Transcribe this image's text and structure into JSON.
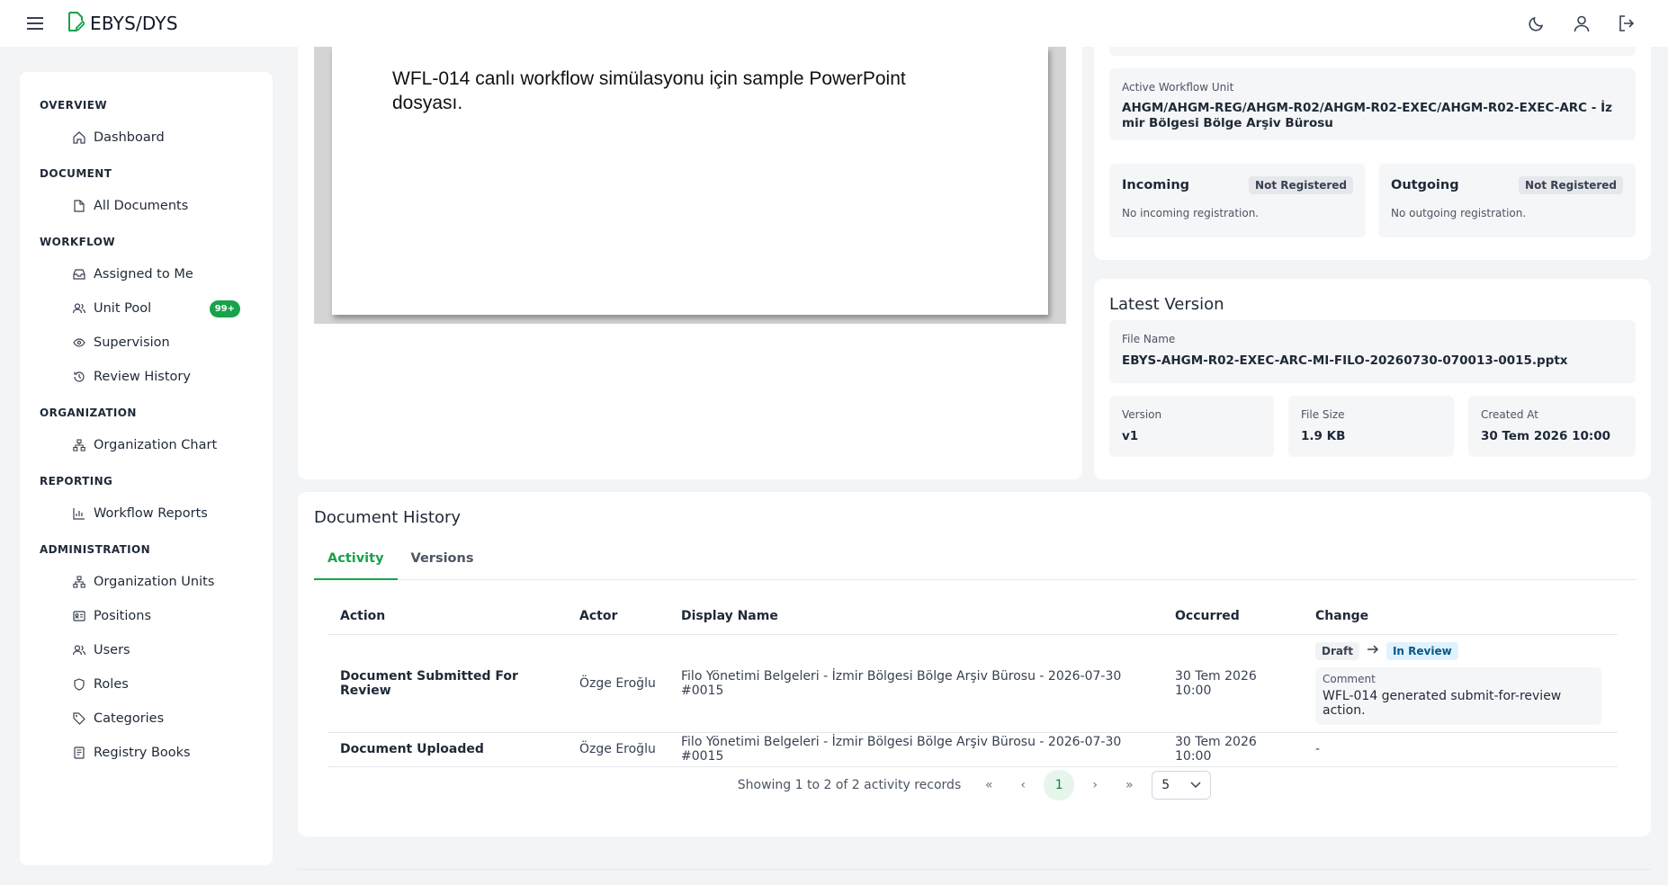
{
  "app": {
    "brand": "EBYS/DYS",
    "accent": "#16a34a"
  },
  "sidebar": {
    "sections": [
      {
        "title": "OVERVIEW",
        "items": [
          {
            "label": "Dashboard",
            "icon": "home-icon"
          }
        ]
      },
      {
        "title": "DOCUMENT",
        "items": [
          {
            "label": "All Documents",
            "icon": "file-icon"
          }
        ]
      },
      {
        "title": "WORKFLOW",
        "items": [
          {
            "label": "Assigned to Me",
            "icon": "inbox-icon"
          },
          {
            "label": "Unit Pool",
            "icon": "users-icon",
            "badge": "99+"
          },
          {
            "label": "Supervision",
            "icon": "eye-icon"
          },
          {
            "label": "Review History",
            "icon": "history-icon"
          }
        ]
      },
      {
        "title": "ORGANIZATION",
        "items": [
          {
            "label": "Organization Chart",
            "icon": "org-chart-icon"
          }
        ]
      },
      {
        "title": "REPORTING",
        "items": [
          {
            "label": "Workflow Reports",
            "icon": "bar-chart-icon"
          }
        ]
      },
      {
        "title": "ADMINISTRATION",
        "items": [
          {
            "label": "Organization Units",
            "icon": "org-chart-icon"
          },
          {
            "label": "Positions",
            "icon": "id-card-icon"
          },
          {
            "label": "Users",
            "icon": "users-icon"
          },
          {
            "label": "Roles",
            "icon": "shield-icon"
          },
          {
            "label": "Categories",
            "icon": "tag-icon"
          },
          {
            "label": "Registry Books",
            "icon": "book-icon"
          }
        ]
      }
    ]
  },
  "preview": {
    "slide_text": "WFL-014 canlı workflow simülasyonu için sample PowerPoint dosyası."
  },
  "info": {
    "active_unit_label": "Active Workflow Unit",
    "active_unit_value": "AHGM/AHGM-REG/AHGM-R02/AHGM-R02-EXEC/AHGM-R02-EXEC-ARC - İzmir Bölgesi Bölge Arşiv Bürosu",
    "incoming": {
      "title": "Incoming",
      "status": "Not Registered",
      "text": "No incoming registration."
    },
    "outgoing": {
      "title": "Outgoing",
      "status": "Not Registered",
      "text": "No outgoing registration."
    }
  },
  "version": {
    "title": "Latest Version",
    "file_name_label": "File Name",
    "file_name": "EBYS-AHGM-R02-EXEC-ARC-MI-FILO-20260730-070013-0015.pptx",
    "version_label": "Version",
    "version": "v1",
    "size_label": "File Size",
    "size": "1.9 KB",
    "created_label": "Created At",
    "created": "30 Tem 2026 10:00"
  },
  "history": {
    "title": "Document History",
    "tabs": [
      "Activity",
      "Versions"
    ],
    "columns": [
      "Action",
      "Actor",
      "Display Name",
      "Occurred",
      "Change"
    ],
    "rows": [
      {
        "action": "Document Submitted For Review",
        "actor": "Özge Eroğlu",
        "display_name": "Filo Yönetimi Belgeleri - İzmir Bölgesi Bölge Arşiv Bürosu - 2026-07-30 #0015",
        "occurred": "30 Tem 2026 10:00",
        "from": "Draft",
        "to": "In Review",
        "comment_label": "Comment",
        "comment": "WFL-014 generated submit-for-review action."
      },
      {
        "action": "Document Uploaded",
        "actor": "Özge Eroğlu",
        "display_name": "Filo Yönetimi Belgeleri - İzmir Bölgesi Bölge Arşiv Bürosu - 2026-07-30 #0015",
        "occurred": "30 Tem 2026 10:00",
        "change": "-"
      }
    ],
    "pager": {
      "summary": "Showing 1 to 2 of 2 activity records",
      "first": "«",
      "prev": "‹",
      "current": "1",
      "next": "›",
      "last": "»",
      "page_size": "5"
    }
  }
}
